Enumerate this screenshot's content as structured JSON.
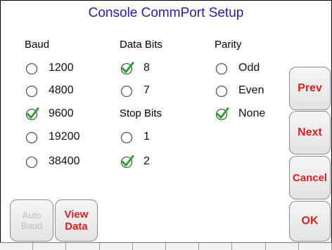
{
  "title": "Console CommPort Setup",
  "baud": {
    "header": "Baud",
    "options": [
      "1200",
      "4800",
      "9600",
      "19200",
      "38400"
    ],
    "selected": "9600"
  },
  "data_bits": {
    "header": "Data Bits",
    "options": [
      "8",
      "7"
    ],
    "selected": "8"
  },
  "stop_bits": {
    "header": "Stop Bits",
    "options": [
      "1",
      "2"
    ],
    "selected": "2"
  },
  "parity": {
    "header": "Parity",
    "options": [
      "Odd",
      "Even",
      "None"
    ],
    "selected": "None"
  },
  "buttons": {
    "prev": "Prev",
    "next": "Next",
    "cancel": "Cancel",
    "ok": "OK",
    "auto_baud_line1": "Auto",
    "auto_baud_line2": "Baud",
    "view_data_line1": "View",
    "view_data_line2": "Data"
  },
  "colors": {
    "title": "#1f1fb4",
    "button_text": "#e31d1d",
    "check": "#2aa52a"
  }
}
